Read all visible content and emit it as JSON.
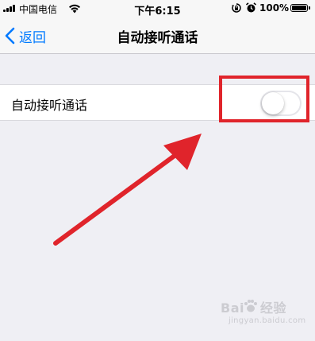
{
  "status_bar": {
    "carrier": "中国电信",
    "time": "下午6:15",
    "battery_percent": "100%",
    "battery_level": 1.0,
    "icons": [
      "signal-icon",
      "wifi-icon",
      "rotation-lock-icon",
      "alarm-icon",
      "battery-icon"
    ]
  },
  "nav": {
    "back_label": "返回",
    "title": "自动接听通话"
  },
  "row": {
    "label": "自动接听通话",
    "toggle_on": false
  },
  "annotation": {
    "highlight_color": "#e0242b",
    "arrow_color": "#e0242b"
  },
  "watermark": {
    "logo_text_left": "Bai",
    "logo_text_right": "经验",
    "url": "jingyan.baidu.com"
  },
  "colors": {
    "accent": "#007aff",
    "background": "#efeff4",
    "bar": "#f7f7f7"
  }
}
